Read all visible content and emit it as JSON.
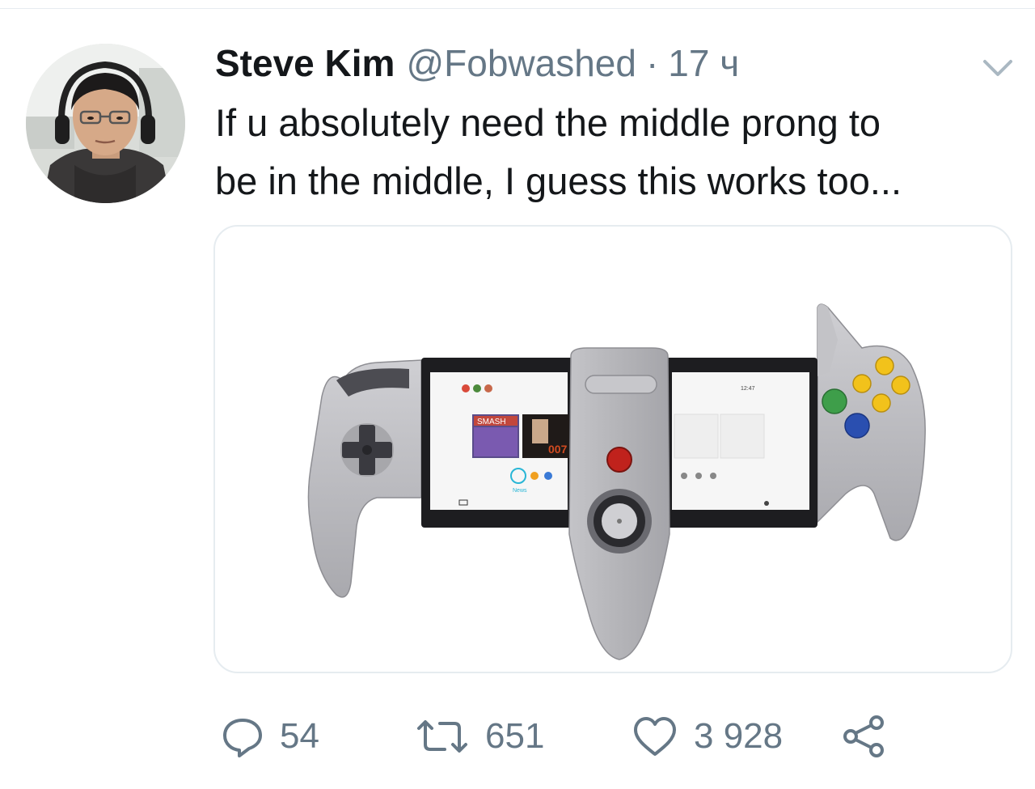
{
  "tweet": {
    "author": {
      "display_name": "Steve Kim",
      "handle": "@Fobwashed",
      "avatar_icon": "avatar-photo"
    },
    "separator": "·",
    "time": "17 ч",
    "menu_icon": "chevron-down-icon",
    "text_lines": [
      "If u absolutely need the middle prong to",
      "be in the middle, I guess this works too..."
    ],
    "media": {
      "subject": "controller-photo",
      "screen_left_tiles": [
        "SMASH",
        "007"
      ],
      "screen_left_label": "News",
      "screen_right_clock": "12:47"
    },
    "actions": {
      "reply_count": "54",
      "retweet_count": "651",
      "like_count": "3 928",
      "share_icon": "share-icon"
    }
  },
  "colors": {
    "text_primary": "#14171a",
    "text_secondary": "#657786",
    "divider": "#e6ecf0",
    "controller_gray": "#b8b8bc",
    "button_yellow": "#f2c21b",
    "button_green": "#3e9e4a",
    "button_blue": "#2a4fb0",
    "button_red": "#c0221c"
  }
}
